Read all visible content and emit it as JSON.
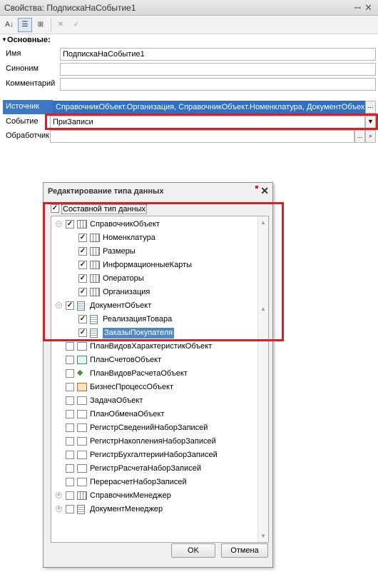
{
  "panel": {
    "title": "Свойства: ПодпискаНаСобытие1",
    "section": "Основные:",
    "fields": [
      {
        "label": "Имя",
        "value": "ПодпискаНаСобытие1"
      },
      {
        "label": "Синоним",
        "value": ""
      },
      {
        "label": "Комментарий",
        "value": ""
      },
      {
        "label": "Источник",
        "value": "СправочникОбъект.Организация, СправочникОбъект.Номенклатура, ДокументОбъект"
      },
      {
        "label": "Событие",
        "value": "ПриЗаписи"
      },
      {
        "label": "Обработчик",
        "value": ""
      }
    ],
    "buttons": {
      "ellipsis": "...",
      "dropdown": "▼",
      "search": "🔍"
    }
  },
  "dialog": {
    "title": "Редактирование типа данных",
    "composite_label": "Составной тип данных",
    "composite_checked": true,
    "tree": [
      {
        "label": "СправочникОбъект",
        "level": 0,
        "expander": "⊖",
        "checked": true,
        "icon": "table-icon"
      },
      {
        "label": "Номенклатура",
        "level": 1,
        "checked": true,
        "icon": "table-icon"
      },
      {
        "label": "Размеры",
        "level": 1,
        "checked": true,
        "icon": "table-icon"
      },
      {
        "label": "ИнформационныеКарты",
        "level": 1,
        "checked": true,
        "icon": "table-icon"
      },
      {
        "label": "Операторы",
        "level": 1,
        "checked": true,
        "icon": "table-icon"
      },
      {
        "label": "Организация",
        "level": 1,
        "checked": true,
        "icon": "table-icon"
      },
      {
        "label": "ДокументОбъект",
        "level": 0,
        "expander": "⊖",
        "checked": true,
        "icon": "document-icon"
      },
      {
        "label": "РеализацияТовара",
        "level": 1,
        "checked": true,
        "icon": "document-icon"
      },
      {
        "label": "ЗаказыПокупателя",
        "level": 1,
        "checked": true,
        "icon": "document-icon",
        "selected": true
      },
      {
        "label": "ПланВидовХарактеристикОбъект",
        "level": 0,
        "checked": false,
        "icon": "chart-plan-icon"
      },
      {
        "label": "ПланСчетовОбъект",
        "level": 0,
        "checked": false,
        "icon": "accounts-plan-icon"
      },
      {
        "label": "ПланВидовРасчетаОбъект",
        "level": 0,
        "checked": false,
        "icon": "calc-plan-icon"
      },
      {
        "label": "БизнесПроцессОбъект",
        "level": 0,
        "checked": false,
        "icon": "business-process-icon"
      },
      {
        "label": "ЗадачаОбъект",
        "level": 0,
        "checked": false,
        "icon": "task-icon"
      },
      {
        "label": "ПланОбменаОбъект",
        "level": 0,
        "checked": false,
        "icon": "exchange-plan-icon"
      },
      {
        "label": "РегистрСведенийНаборЗаписей",
        "level": 0,
        "checked": false,
        "icon": "info-register-icon"
      },
      {
        "label": "РегистрНакопленияНаборЗаписей",
        "level": 0,
        "checked": false,
        "icon": "accum-register-icon"
      },
      {
        "label": "РегистрБухгалтерииНаборЗаписей",
        "level": 0,
        "checked": false,
        "icon": "accounting-register-icon"
      },
      {
        "label": "РегистрРасчетаНаборЗаписей",
        "level": 0,
        "checked": false,
        "icon": "calc-register-icon"
      },
      {
        "label": "ПерерасчетНаборЗаписей",
        "level": 0,
        "checked": false,
        "icon": "recalc-icon"
      },
      {
        "label": "СправочникМенеджер",
        "level": 0,
        "expander": "⊕",
        "checked": false,
        "icon": "table-icon"
      },
      {
        "label": "ДокументМенеджер",
        "level": 0,
        "expander": "⊕",
        "checked": false,
        "icon": "document-icon"
      }
    ],
    "ok_label": "OK",
    "cancel_label": "Отмена"
  },
  "colors": {
    "highlight": "#e21c24",
    "selection": "#4f88c9"
  }
}
